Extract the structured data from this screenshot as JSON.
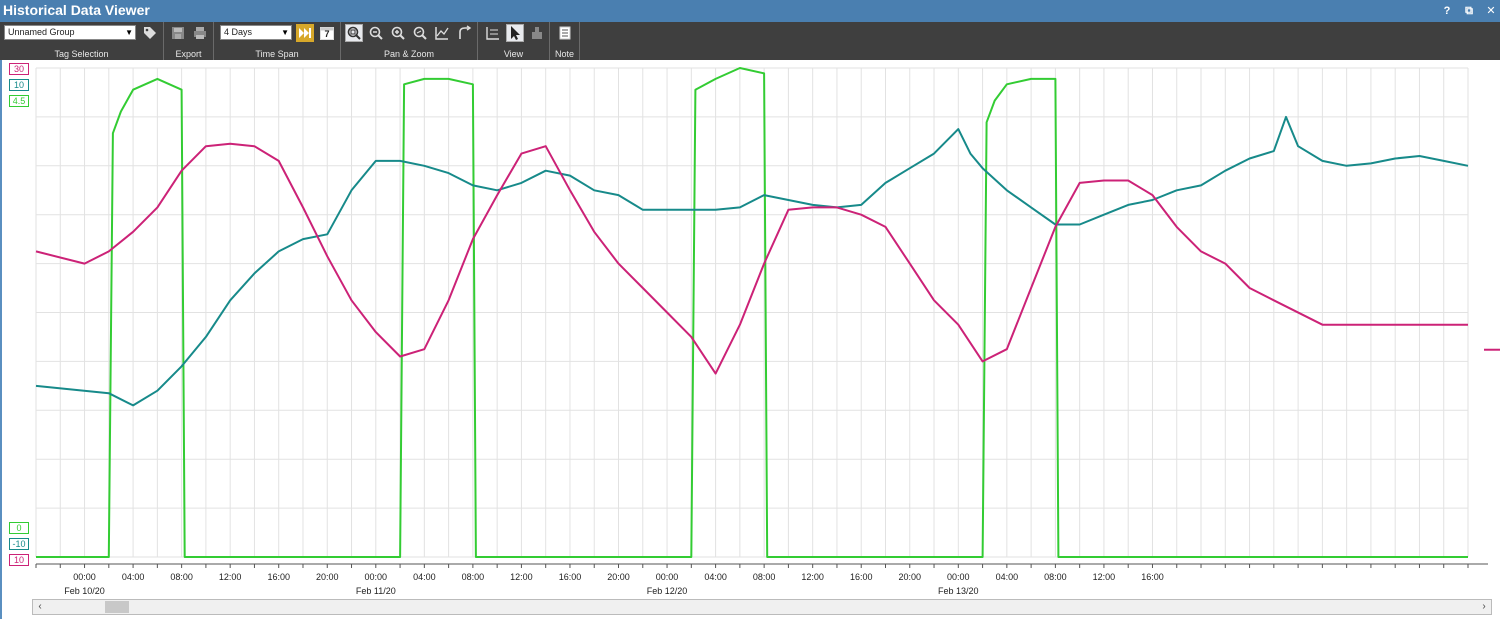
{
  "window": {
    "title": "Historical Data Viewer",
    "help_label": "?",
    "restore_label": "⧉",
    "close_label": "✕"
  },
  "toolbar": {
    "group_select": {
      "value": "Unnamed Group"
    },
    "timespan_select": {
      "value": "4 Days"
    },
    "groups": {
      "tag_selection": "Tag Selection",
      "export": "Export",
      "time_span": "Time Span",
      "pan_zoom": "Pan & Zoom",
      "view": "View",
      "note": "Note"
    },
    "calendar_day": "7"
  },
  "colors": {
    "green": "#33cc33",
    "teal": "#178a8a",
    "magenta": "#cc2277",
    "toolbar_bg": "#3f3f3f",
    "title_bg": "#4a7fb0",
    "grid": "#e2e2e2",
    "accent_button": "#d7a82a"
  },
  "chart_data": {
    "type": "line",
    "x_start": "2020-02-09 20:00",
    "x_end": "2020-02-14 18:00",
    "x_tick_labels": [
      "00:00",
      "04:00",
      "08:00",
      "12:00",
      "16:00",
      "20:00",
      "00:00",
      "04:00",
      "08:00",
      "12:00",
      "16:00",
      "20:00",
      "00:00",
      "04:00",
      "08:00",
      "12:00",
      "16:00",
      "20:00",
      "00:00",
      "04:00",
      "08:00",
      "12:00",
      "16:00"
    ],
    "date_labels": [
      "Feb 10/20",
      "Feb 11/20",
      "Feb 12/20",
      "Feb 13/20"
    ],
    "grid": true,
    "series": [
      {
        "color": "#33cc33",
        "axis_max_label": "4.5",
        "axis_min_label": "0",
        "ylim": [
          0,
          4.5
        ],
        "points": [
          [
            "2020-02-09 20:00",
            0.0
          ],
          [
            "2020-02-10 02:00",
            0.0
          ],
          [
            "2020-02-10 02:20",
            3.9
          ],
          [
            "2020-02-10 03:00",
            4.1
          ],
          [
            "2020-02-10 04:00",
            4.3
          ],
          [
            "2020-02-10 05:00",
            4.35
          ],
          [
            "2020-02-10 06:00",
            4.4
          ],
          [
            "2020-02-10 07:00",
            4.35
          ],
          [
            "2020-02-10 08:00",
            4.3
          ],
          [
            "2020-02-10 08:15",
            0.0
          ],
          [
            "2020-02-11 02:00",
            0.0
          ],
          [
            "2020-02-11 02:20",
            4.35
          ],
          [
            "2020-02-11 04:00",
            4.4
          ],
          [
            "2020-02-11 06:00",
            4.4
          ],
          [
            "2020-02-11 08:00",
            4.35
          ],
          [
            "2020-02-11 08:15",
            0.0
          ],
          [
            "2020-02-12 02:00",
            0.0
          ],
          [
            "2020-02-12 02:20",
            4.3
          ],
          [
            "2020-02-12 04:00",
            4.4
          ],
          [
            "2020-02-12 06:00",
            4.5
          ],
          [
            "2020-02-12 08:00",
            4.45
          ],
          [
            "2020-02-12 08:15",
            0.0
          ],
          [
            "2020-02-13 02:00",
            0.0
          ],
          [
            "2020-02-13 02:20",
            4.0
          ],
          [
            "2020-02-13 03:00",
            4.2
          ],
          [
            "2020-02-13 04:00",
            4.35
          ],
          [
            "2020-02-13 06:00",
            4.4
          ],
          [
            "2020-02-13 08:00",
            4.4
          ],
          [
            "2020-02-13 08:15",
            0.0
          ],
          [
            "2020-02-14 18:00",
            0.0
          ]
        ]
      },
      {
        "color": "#178a8a",
        "axis_max_label": "10",
        "axis_min_label": "-10",
        "ylim": [
          -10,
          10
        ],
        "points": [
          [
            "2020-02-09 20:00",
            -3.0
          ],
          [
            "2020-02-10 02:00",
            -3.3
          ],
          [
            "2020-02-10 04:00",
            -3.8
          ],
          [
            "2020-02-10 06:00",
            -3.2
          ],
          [
            "2020-02-10 08:00",
            -2.2
          ],
          [
            "2020-02-10 10:00",
            -1.0
          ],
          [
            "2020-02-10 12:00",
            0.5
          ],
          [
            "2020-02-10 14:00",
            1.6
          ],
          [
            "2020-02-10 16:00",
            2.5
          ],
          [
            "2020-02-10 18:00",
            3.0
          ],
          [
            "2020-02-10 20:00",
            3.2
          ],
          [
            "2020-02-10 22:00",
            5.0
          ],
          [
            "2020-02-11 00:00",
            6.2
          ],
          [
            "2020-02-11 02:00",
            6.2
          ],
          [
            "2020-02-11 04:00",
            6.0
          ],
          [
            "2020-02-11 06:00",
            5.7
          ],
          [
            "2020-02-11 08:00",
            5.2
          ],
          [
            "2020-02-11 10:00",
            5.0
          ],
          [
            "2020-02-11 12:00",
            5.3
          ],
          [
            "2020-02-11 14:00",
            5.8
          ],
          [
            "2020-02-11 16:00",
            5.6
          ],
          [
            "2020-02-11 18:00",
            5.0
          ],
          [
            "2020-02-11 20:00",
            4.8
          ],
          [
            "2020-02-11 22:00",
            4.2
          ],
          [
            "2020-02-12 00:00",
            4.2
          ],
          [
            "2020-02-12 04:00",
            4.2
          ],
          [
            "2020-02-12 06:00",
            4.3
          ],
          [
            "2020-02-12 08:00",
            4.8
          ],
          [
            "2020-02-12 10:00",
            4.6
          ],
          [
            "2020-02-12 12:00",
            4.4
          ],
          [
            "2020-02-12 14:00",
            4.3
          ],
          [
            "2020-02-12 16:00",
            4.4
          ],
          [
            "2020-02-12 18:00",
            5.3
          ],
          [
            "2020-02-12 20:00",
            5.9
          ],
          [
            "2020-02-12 22:00",
            6.5
          ],
          [
            "2020-02-13 00:00",
            7.5
          ],
          [
            "2020-02-13 01:00",
            6.5
          ],
          [
            "2020-02-13 02:00",
            5.9
          ],
          [
            "2020-02-13 04:00",
            5.0
          ],
          [
            "2020-02-13 06:00",
            4.3
          ],
          [
            "2020-02-13 08:00",
            3.6
          ],
          [
            "2020-02-13 10:00",
            3.6
          ],
          [
            "2020-02-13 12:00",
            4.0
          ],
          [
            "2020-02-13 14:00",
            4.4
          ],
          [
            "2020-02-13 16:00",
            4.6
          ],
          [
            "2020-02-13 18:00",
            5.0
          ],
          [
            "2020-02-13 20:00",
            5.2
          ],
          [
            "2020-02-13 22:00",
            5.8
          ],
          [
            "2020-02-14 00:00",
            6.3
          ],
          [
            "2020-02-14 02:00",
            6.6
          ],
          [
            "2020-02-14 03:00",
            8.0
          ],
          [
            "2020-02-14 04:00",
            6.8
          ],
          [
            "2020-02-14 06:00",
            6.2
          ],
          [
            "2020-02-14 08:00",
            6.0
          ],
          [
            "2020-02-14 10:00",
            6.1
          ],
          [
            "2020-02-14 12:00",
            6.3
          ],
          [
            "2020-02-14 14:00",
            6.4
          ],
          [
            "2020-02-14 16:00",
            6.2
          ],
          [
            "2020-02-14 18:00",
            6.0
          ]
        ]
      },
      {
        "color": "#cc2277",
        "axis_max_label": "30",
        "axis_min_label": "10",
        "ylim": [
          10,
          30
        ],
        "points": [
          [
            "2020-02-09 20:00",
            22.5
          ],
          [
            "2020-02-10 00:00",
            22.0
          ],
          [
            "2020-02-10 02:00",
            22.5
          ],
          [
            "2020-02-10 04:00",
            23.3
          ],
          [
            "2020-02-10 06:00",
            24.3
          ],
          [
            "2020-02-10 08:00",
            25.8
          ],
          [
            "2020-02-10 10:00",
            26.8
          ],
          [
            "2020-02-10 12:00",
            26.9
          ],
          [
            "2020-02-10 14:00",
            26.8
          ],
          [
            "2020-02-10 16:00",
            26.2
          ],
          [
            "2020-02-10 18:00",
            24.3
          ],
          [
            "2020-02-10 20:00",
            22.3
          ],
          [
            "2020-02-10 22:00",
            20.5
          ],
          [
            "2020-02-11 00:00",
            19.2
          ],
          [
            "2020-02-11 02:00",
            18.2
          ],
          [
            "2020-02-11 04:00",
            18.5
          ],
          [
            "2020-02-11 06:00",
            20.5
          ],
          [
            "2020-02-11 08:00",
            23.0
          ],
          [
            "2020-02-11 10:00",
            24.8
          ],
          [
            "2020-02-11 12:00",
            26.5
          ],
          [
            "2020-02-11 14:00",
            26.8
          ],
          [
            "2020-02-11 16:00",
            25.0
          ],
          [
            "2020-02-11 18:00",
            23.3
          ],
          [
            "2020-02-11 20:00",
            22.0
          ],
          [
            "2020-02-11 22:00",
            21.0
          ],
          [
            "2020-02-12 00:00",
            20.0
          ],
          [
            "2020-02-12 02:00",
            19.0
          ],
          [
            "2020-02-12 04:00",
            17.5
          ],
          [
            "2020-02-12 06:00",
            19.5
          ],
          [
            "2020-02-12 08:00",
            22.0
          ],
          [
            "2020-02-12 10:00",
            24.2
          ],
          [
            "2020-02-12 12:00",
            24.3
          ],
          [
            "2020-02-12 14:00",
            24.3
          ],
          [
            "2020-02-12 16:00",
            24.0
          ],
          [
            "2020-02-12 18:00",
            23.5
          ],
          [
            "2020-02-12 20:00",
            22.0
          ],
          [
            "2020-02-12 22:00",
            20.5
          ],
          [
            "2020-02-13 00:00",
            19.5
          ],
          [
            "2020-02-13 02:00",
            18.0
          ],
          [
            "2020-02-13 04:00",
            18.5
          ],
          [
            "2020-02-13 06:00",
            21.0
          ],
          [
            "2020-02-13 08:00",
            23.5
          ],
          [
            "2020-02-13 10:00",
            25.3
          ],
          [
            "2020-02-13 12:00",
            25.4
          ],
          [
            "2020-02-13 14:00",
            25.4
          ],
          [
            "2020-02-13 16:00",
            24.8
          ],
          [
            "2020-02-13 18:00",
            23.5
          ],
          [
            "2020-02-13 20:00",
            22.5
          ],
          [
            "2020-02-13 22:00",
            22.0
          ],
          [
            "2020-02-14 00:00",
            21.0
          ],
          [
            "2020-02-14 02:00",
            20.5
          ],
          [
            "2020-02-14 06:00",
            19.5
          ],
          [
            "2020-02-14 18:00",
            19.5
          ]
        ]
      }
    ]
  }
}
